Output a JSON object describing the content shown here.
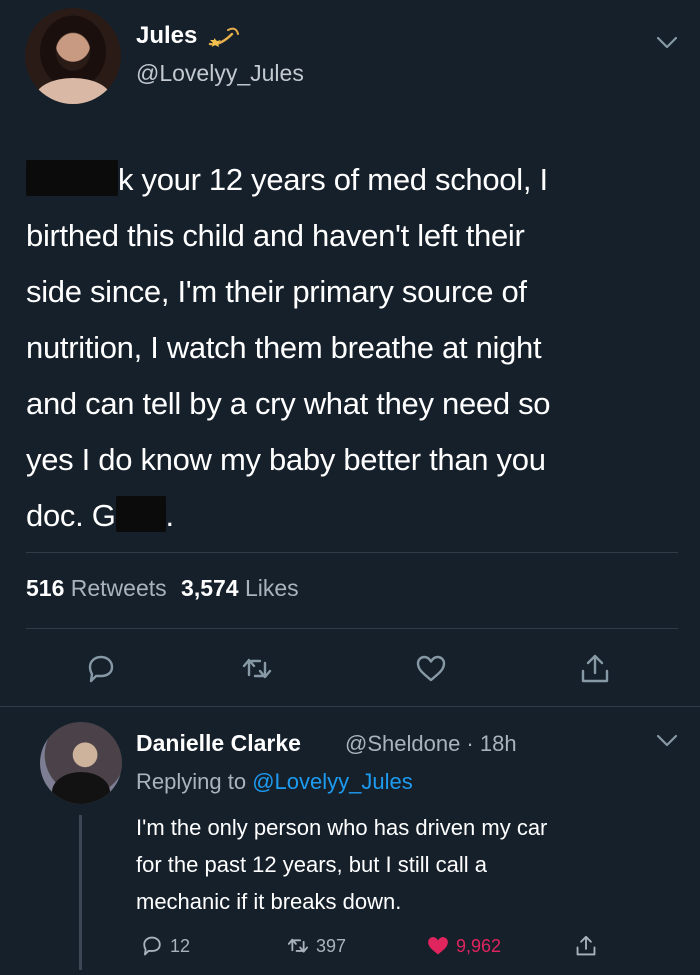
{
  "tweet": {
    "display_name": "Jules",
    "handle": "@Lovelyy_Jules",
    "text_lines": [
      "k your 12 years of med school, I",
      "birthed this child and haven't left their",
      "side since, I'm their primary source of",
      "nutrition, I watch them breathe at night",
      "and can tell by a cry what they need so",
      "yes I do know my baby better than you",
      "doc. G",
      "."
    ],
    "retweet_count": "516",
    "retweet_label": "Retweets",
    "like_count": "3,574",
    "like_label": "Likes",
    "icons": {
      "badge": "shooting-star-icon",
      "menu": "chevron-down-icon",
      "reply": "reply-icon",
      "retweet": "retweet-icon",
      "like": "heart-icon",
      "share": "share-icon"
    }
  },
  "reply": {
    "display_name": "Danielle Clarke",
    "handle_time": "@Sheldone · 18h",
    "replying_prefix": "Replying to",
    "replying_mention": "@Lovelyy_Jules",
    "text_lines": [
      "I'm the only person who has driven my car",
      "for the past 12 years, but I still call a",
      "mechanic if it breaks down."
    ],
    "reply_count": "12",
    "retweet_count": "397",
    "like_count": "9,962",
    "liked": true
  },
  "colors": {
    "background": "#15202b",
    "secondary_text": "#aab3bc",
    "link": "#1d9bf0",
    "like": "#e0245e"
  }
}
